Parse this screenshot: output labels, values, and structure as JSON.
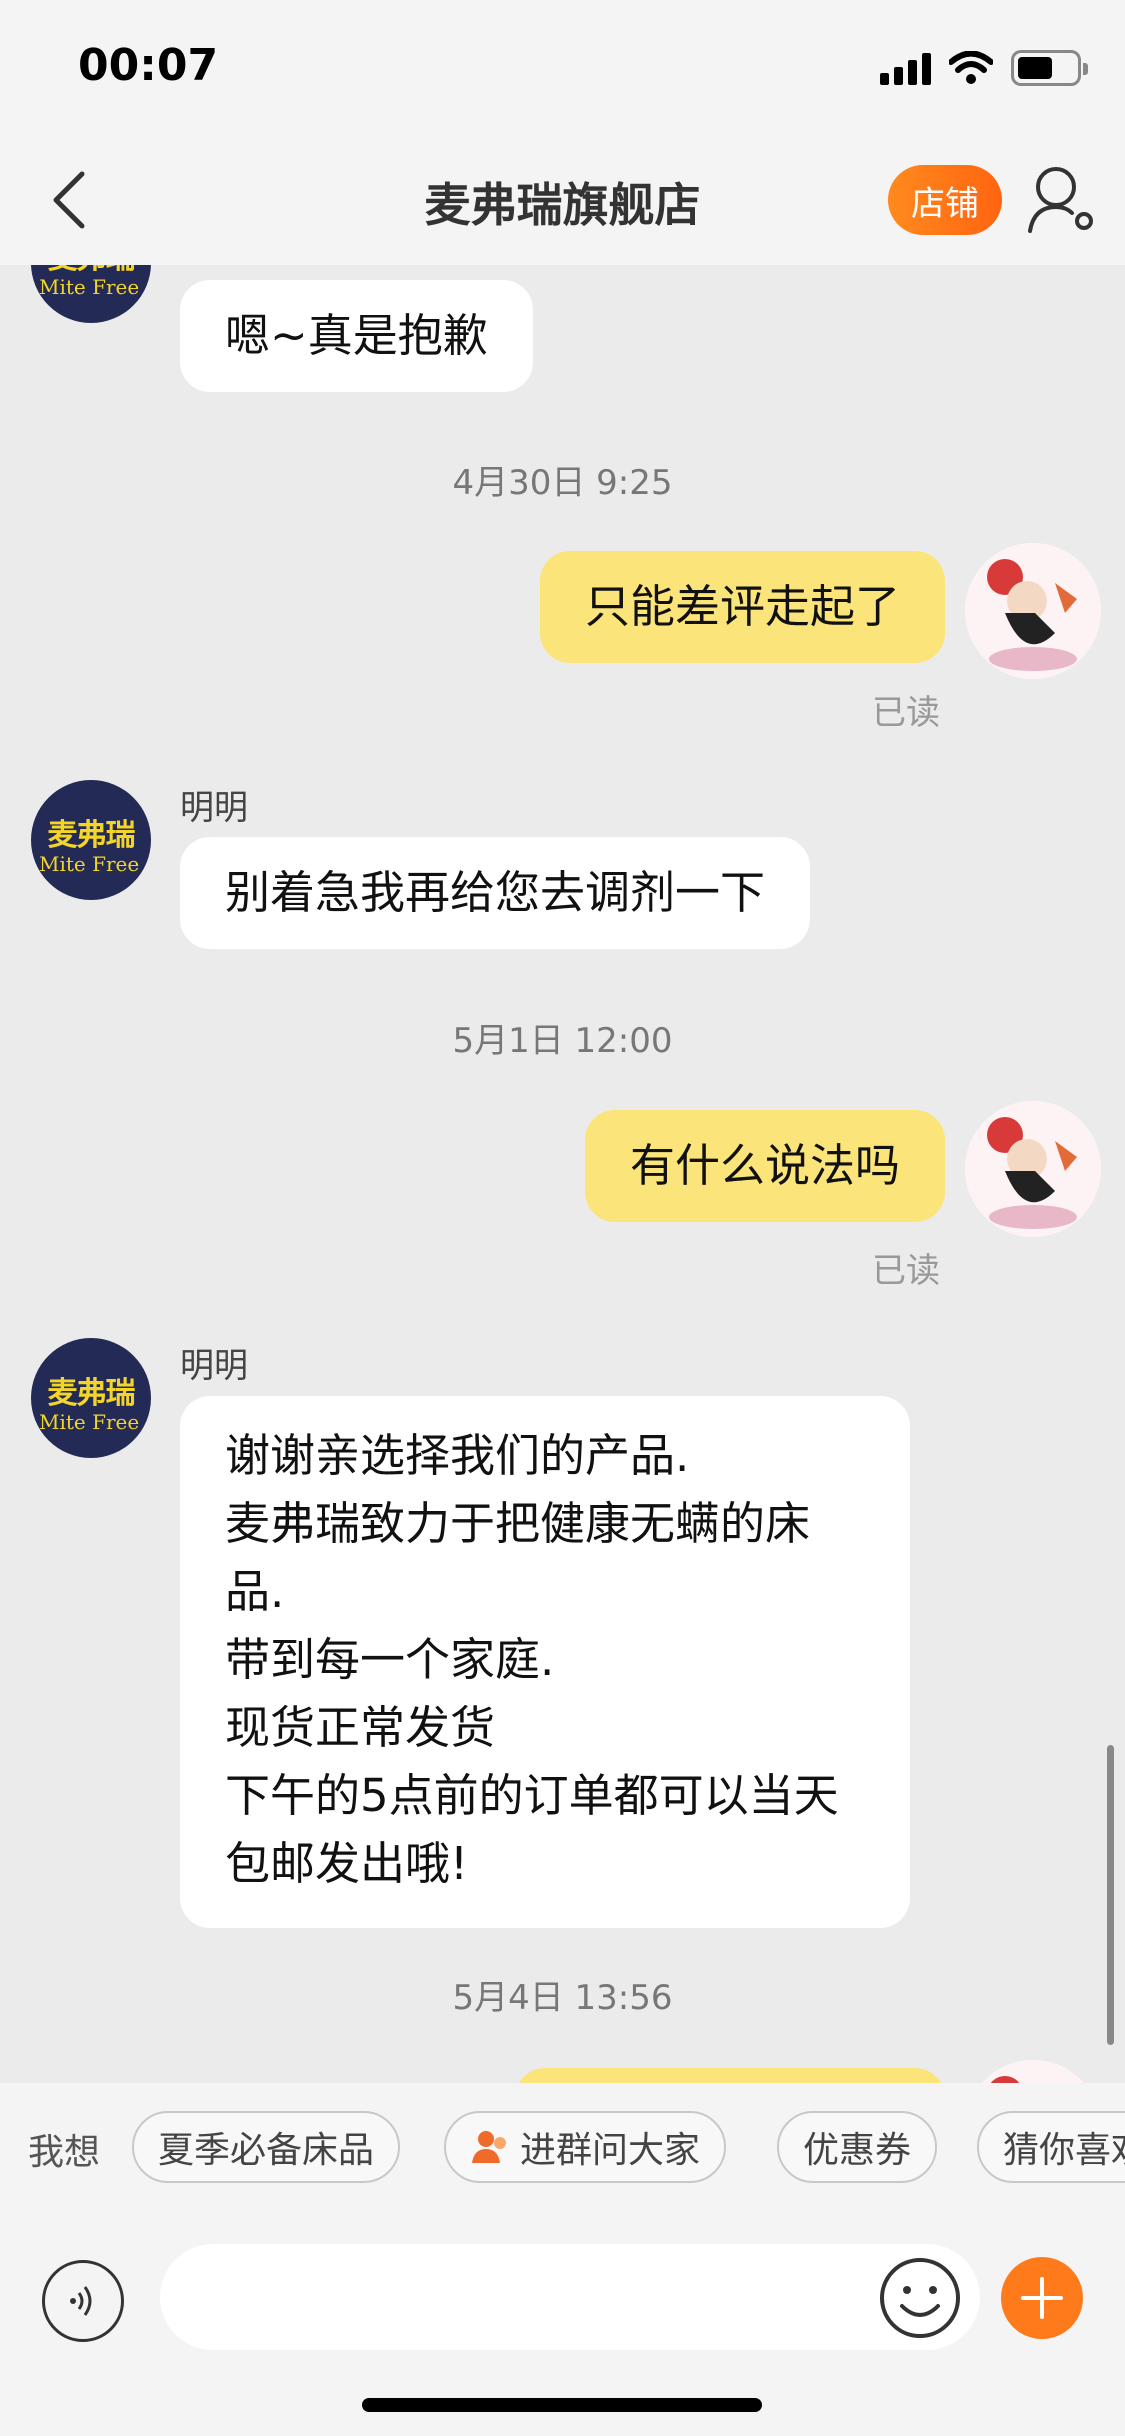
{
  "status_bar": {
    "time": "00:07"
  },
  "nav": {
    "title": "麦弗瑞旗舰店",
    "shop_button": "店铺"
  },
  "shop_avatar": {
    "logo_cn": "麦弗瑞",
    "logo_en": "Mite Free"
  },
  "messages": {
    "m0": {
      "text": "嗯~真是抱歉"
    },
    "ts1": "4月30日 9:25",
    "m1": {
      "text": "只能差评走起了",
      "status": "已读"
    },
    "m2": {
      "sender": "明明",
      "text": "别着急我再给您去调剂一下"
    },
    "ts2": "5月1日 12:00",
    "m3": {
      "text": "有什么说法吗",
      "status": "已读"
    },
    "m4": {
      "sender": "明明",
      "text": "谢谢亲选择我们的产品.\n麦弗瑞致力于把健康无螨的床品.\n带到每一个家庭.\n现货正常发货\n下午的5点前的订单都可以当天包邮发出哦!"
    },
    "ts3": "5月4日 13:56"
  },
  "quick_replies": {
    "label": "我想",
    "chips": [
      "夏季必备床品",
      "进群问大家",
      "优惠券",
      "猜你喜欢"
    ]
  },
  "input": {
    "placeholder": ""
  },
  "colors": {
    "accent": "#ff7a1a",
    "outgoing_bubble": "#fbe57a",
    "incoming_bubble": "#ffffff",
    "shop_avatar_bg": "#232a56"
  },
  "icons": [
    "back-chevron-icon",
    "profile-settings-icon",
    "group-people-icon",
    "voice-icon",
    "emoji-icon",
    "plus-icon",
    "signal-icon",
    "wifi-icon",
    "battery-icon"
  ]
}
